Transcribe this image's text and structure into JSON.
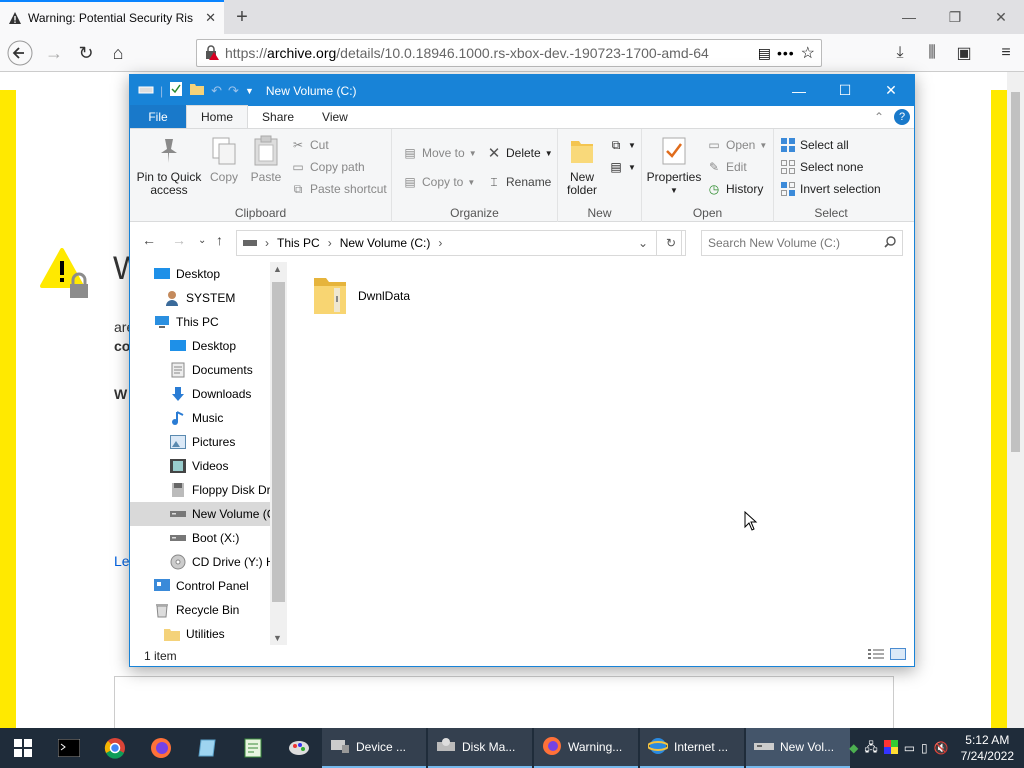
{
  "browser": {
    "tab_title": "Warning: Potential Security Ris",
    "url_prefix": "https://",
    "url_host": "archive.org",
    "url_rest": "/details/10.0.18946.1000.rs-xbox-dev.-190723-1700-amd-64"
  },
  "page": {
    "heading_fragment": "W",
    "line1_fragment": "are",
    "line2_fragment": "co",
    "line3_fragment": "W",
    "link_fragment": "Le"
  },
  "explorer": {
    "title": "New Volume (C:)",
    "tabs": {
      "file": "File",
      "home": "Home",
      "share": "Share",
      "view": "View"
    },
    "clipboard": {
      "pin": "Pin to Quick access",
      "copy": "Copy",
      "paste": "Paste",
      "cut": "Cut",
      "copy_path": "Copy path",
      "paste_shortcut": "Paste shortcut",
      "label": "Clipboard"
    },
    "organize": {
      "move_to": "Move to",
      "copy_to": "Copy to",
      "delete": "Delete",
      "rename": "Rename",
      "label": "Organize"
    },
    "new": {
      "new_folder": "New folder",
      "label": "New"
    },
    "open": {
      "properties": "Properties",
      "open": "Open",
      "edit": "Edit",
      "history": "History",
      "label": "Open"
    },
    "select": {
      "select_all": "Select all",
      "select_none": "Select none",
      "invert": "Invert selection",
      "label": "Select"
    },
    "breadcrumb": [
      "This PC",
      "New Volume (C:)"
    ],
    "search_placeholder": "Search New Volume (C:)",
    "nav_items": [
      {
        "label": "Desktop",
        "icon": "desktop-icon"
      },
      {
        "label": "SYSTEM",
        "icon": "user-icon"
      },
      {
        "label": "This PC",
        "icon": "computer-icon"
      },
      {
        "label": "Desktop",
        "icon": "desktop-icon"
      },
      {
        "label": "Documents",
        "icon": "documents-icon"
      },
      {
        "label": "Downloads",
        "icon": "downloads-icon"
      },
      {
        "label": "Music",
        "icon": "music-icon"
      },
      {
        "label": "Pictures",
        "icon": "pictures-icon"
      },
      {
        "label": "Videos",
        "icon": "videos-icon"
      },
      {
        "label": "Floppy Disk Dri",
        "icon": "floppy-icon"
      },
      {
        "label": "New Volume (C",
        "icon": "drive-icon"
      },
      {
        "label": "Boot (X:)",
        "icon": "drive-icon"
      },
      {
        "label": "CD Drive (Y:) H",
        "icon": "cd-icon"
      },
      {
        "label": "Control Panel",
        "icon": "control-panel-icon"
      },
      {
        "label": "Recycle Bin",
        "icon": "recycle-bin-icon"
      },
      {
        "label": "Utilities",
        "icon": "folder-icon"
      }
    ],
    "files": [
      {
        "name": "DwnlData",
        "icon": "folder-icon"
      }
    ],
    "status": "1 item"
  },
  "taskbar": {
    "tasks": [
      {
        "label": "Device ...",
        "icon": "device-manager-icon"
      },
      {
        "label": "Disk Ma...",
        "icon": "disk-management-icon"
      },
      {
        "label": "Warning...",
        "icon": "firefox-icon"
      },
      {
        "label": "Internet ...",
        "icon": "ie-icon"
      },
      {
        "label": "New Vol...",
        "icon": "drive-icon"
      }
    ],
    "time": "5:12 AM",
    "date": "7/24/2022"
  },
  "colors": {
    "explorer_accent": "#1883d7",
    "warning_yellow": "#ffe900",
    "taskbar_bg": "#1f2c3a"
  }
}
